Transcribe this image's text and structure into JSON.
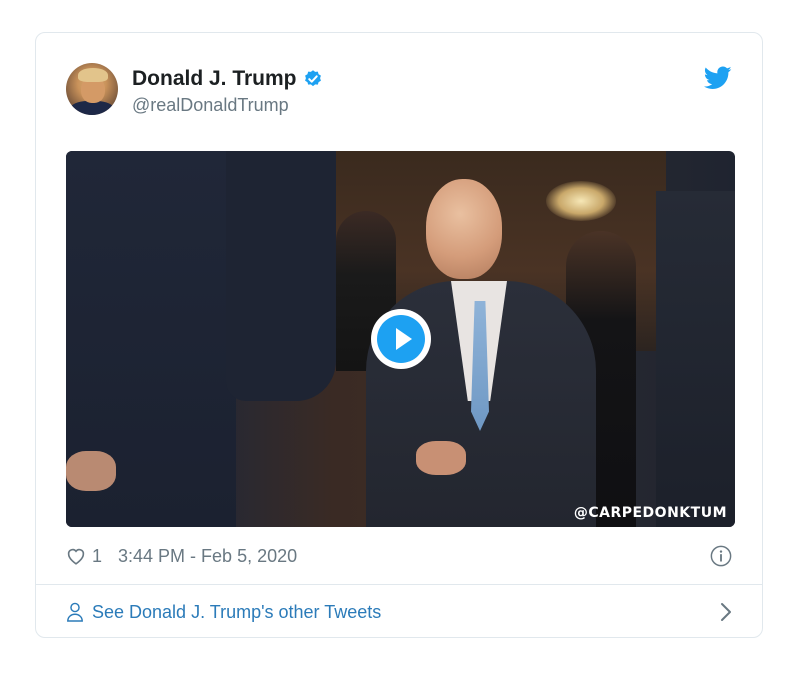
{
  "author": {
    "display_name": "Donald J. Trump",
    "handle": "@realDonaldTrump",
    "verified": true
  },
  "icons": {
    "verified": "verified-badge-icon",
    "brand": "twitter-bird-icon",
    "play": "play-icon",
    "like": "heart-icon",
    "info": "info-icon",
    "profile": "person-icon",
    "chevron": "chevron-right-icon"
  },
  "media": {
    "watermark": "@CARPEDONKTUM"
  },
  "meta": {
    "like_count": "1",
    "timestamp": "3:44 PM - Feb 5, 2020"
  },
  "footer": {
    "link_text": "See Donald J. Trump's other Tweets"
  },
  "colors": {
    "brand_blue": "#1da1f2",
    "link_blue": "#2b7bb9",
    "muted_text": "#697882",
    "border": "#e1e8ed"
  }
}
